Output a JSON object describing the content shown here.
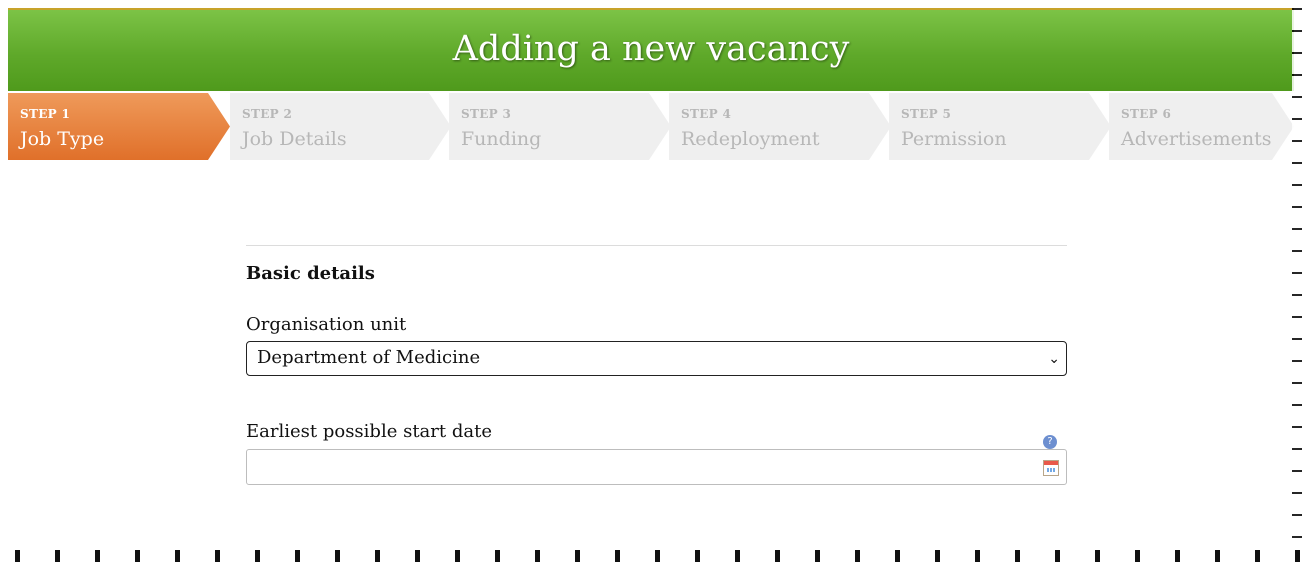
{
  "header": {
    "title": "Adding a new vacancy"
  },
  "steps": [
    {
      "num": "STEP 1",
      "label": "Job Type",
      "active": true
    },
    {
      "num": "STEP 2",
      "label": "Job Details",
      "active": false
    },
    {
      "num": "STEP 3",
      "label": "Funding",
      "active": false
    },
    {
      "num": "STEP 4",
      "label": "Redeployment",
      "active": false
    },
    {
      "num": "STEP 5",
      "label": "Permission",
      "active": false
    },
    {
      "num": "STEP 6",
      "label": "Advertisements",
      "active": false
    }
  ],
  "form": {
    "section_title": "Basic details",
    "org_label": "Organisation unit",
    "org_value": "Department of Medicine",
    "start_label": "Earliest possible start date",
    "start_value": "",
    "help_icon": "help-icon",
    "calendar_icon": "calendar-icon"
  },
  "colors": {
    "header": "#5fa92a",
    "active_step": "#e0702a"
  }
}
